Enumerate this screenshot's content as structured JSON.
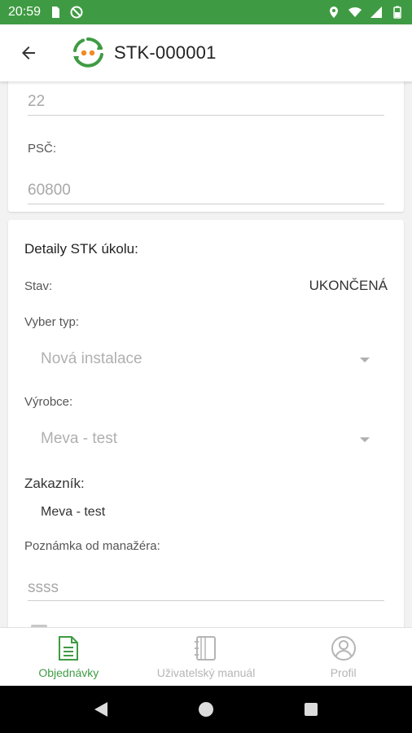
{
  "status_bar": {
    "time": "20:59"
  },
  "app_bar": {
    "title": "STK-000001"
  },
  "top_card": {
    "house_number_value": "22",
    "psc_label": "PSČ:",
    "psc_value": "60800"
  },
  "detail_card": {
    "title": "Detaily STK úkolu:",
    "stav_label": "Stav:",
    "stav_value": "UKONČENÁ",
    "typ_label": "Vyber typ:",
    "typ_value": "Nová instalace",
    "vyrobce_label": "Výrobce:",
    "vyrobce_value": "Meva - test",
    "zakaznik_label": "Zakazník:",
    "zakaznik_value": "Meva - test",
    "poznamka_label": "Poznámka od manažéra:",
    "poznamka_value": "ssss"
  },
  "bottom_nav": {
    "items": [
      {
        "label": "Objednávky",
        "icon": "document-icon",
        "active": true
      },
      {
        "label": "Uživatelský manuál",
        "icon": "book-icon",
        "active": false
      },
      {
        "label": "Profil",
        "icon": "profile-icon",
        "active": false
      }
    ]
  },
  "colors": {
    "brand_green": "#3f9b43",
    "logo_orange": "#f08a24"
  }
}
